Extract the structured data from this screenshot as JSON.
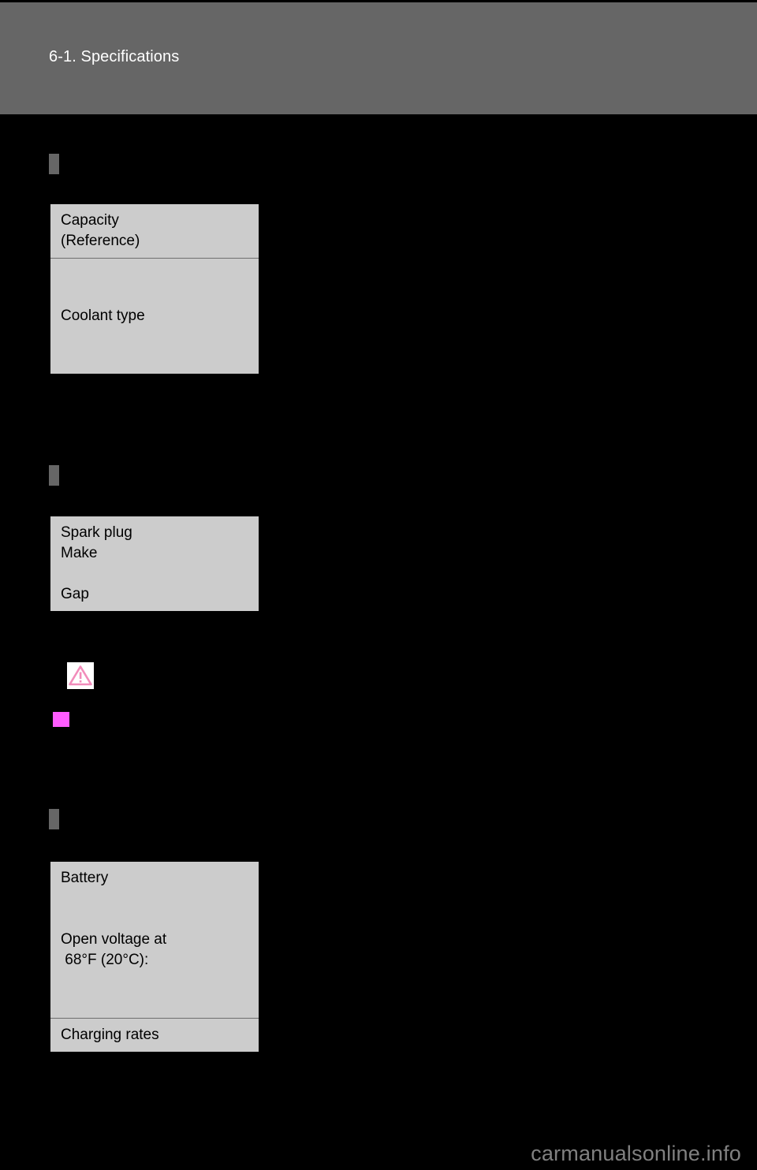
{
  "page": {
    "background_color": "#000000",
    "watermark": "carmanualsonline.info"
  },
  "header": {
    "title": "6-1. Specifications",
    "band_color": "#666666",
    "text_color": "#ffffff"
  },
  "sections": [
    {
      "marker_name": "section-marker-cooling-system",
      "table_name": "cooling-system-table",
      "rows": [
        {
          "lines": [
            "Capacity",
            "(Reference)"
          ]
        },
        {
          "lines": [
            "",
            "",
            "Coolant type",
            "",
            ""
          ]
        }
      ]
    },
    {
      "marker_name": "section-marker-spark-plugs",
      "table_name": "spark-plug-table",
      "rows": [
        {
          "lines": [
            "Spark plug",
            "Make",
            "",
            "Gap"
          ]
        }
      ]
    },
    {
      "marker_name": "section-marker-battery",
      "table_name": "battery-table",
      "rows": [
        {
          "lines": [
            "Battery",
            "",
            "",
            "Open voltage at",
            " 68°F (20°C):",
            "",
            ""
          ]
        },
        {
          "lines": [
            "Charging rates"
          ]
        }
      ]
    }
  ],
  "notices": {
    "warning_icon_name": "warning-triangle-icon",
    "warning_icon_color": "#f28cbb",
    "warning_icon_background": "#ffffff",
    "caution_square_name": "caution-marker",
    "caution_square_color": "#ff5cff"
  },
  "table_style": {
    "fill_color": "#cccccc",
    "border_color": "#000000",
    "divider_color": "#6e6e6e",
    "text_color": "#000000"
  }
}
